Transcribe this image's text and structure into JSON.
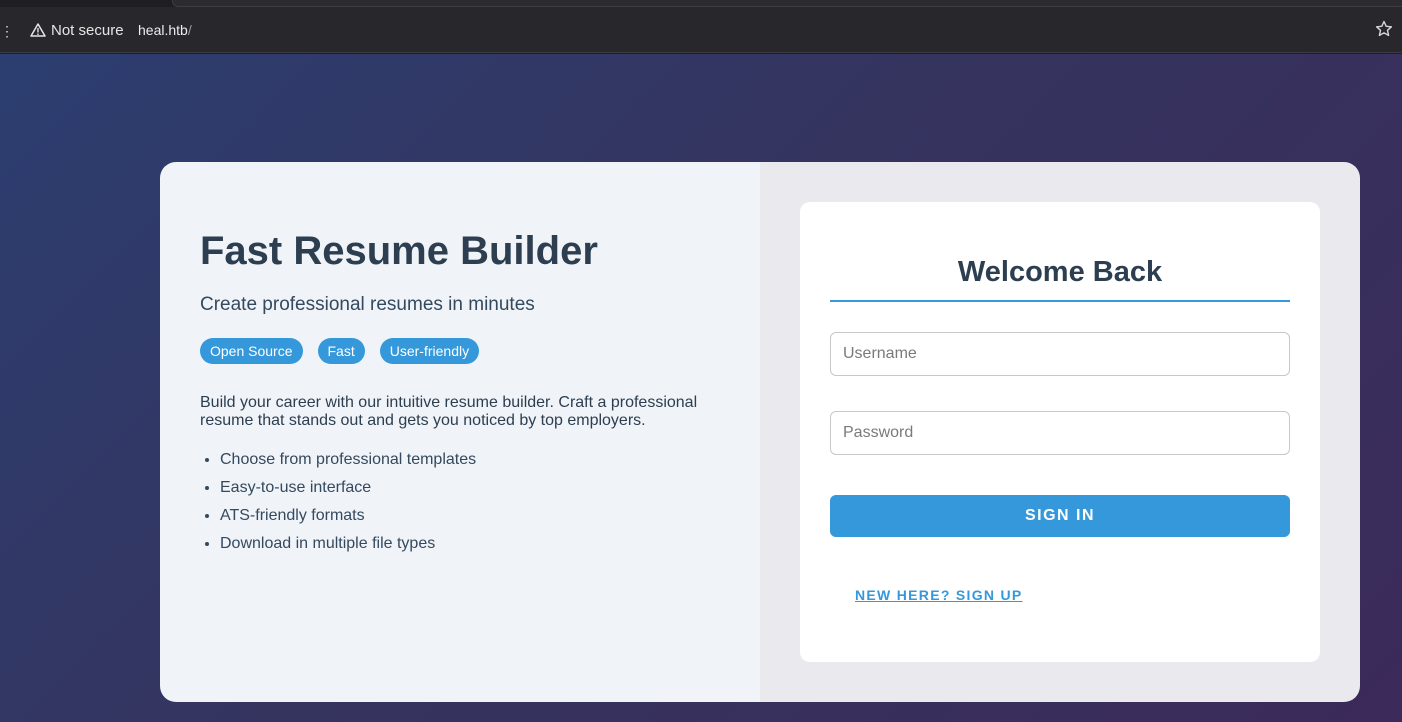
{
  "browser": {
    "security_label": "Not secure",
    "url_host": "heal.htb",
    "url_path": "/",
    "icons": {
      "security": "warning-icon",
      "bookmark": "star-icon"
    }
  },
  "hero": {
    "title": "Fast Resume Builder",
    "subtitle": "Create professional resumes in minutes",
    "tags": [
      "Open Source",
      "Fast",
      "User-friendly"
    ],
    "description": "Build your career with our intuitive resume builder. Craft a professional resume that stands out and gets you noticed by top employers.",
    "features": [
      "Choose from professional templates",
      "Easy-to-use interface",
      "ATS-friendly formats",
      "Download in multiple file types"
    ]
  },
  "login": {
    "title": "Welcome Back",
    "username_placeholder": "Username",
    "username_value": "",
    "password_placeholder": "Password",
    "password_value": "",
    "signin_label": "SIGN IN",
    "signup_label": "NEW HERE? SIGN UP"
  },
  "colors": {
    "accent": "#3498db",
    "heading": "#2c3e50",
    "left_panel": "#f0f3f8",
    "right_panel": "#eae9ee"
  }
}
